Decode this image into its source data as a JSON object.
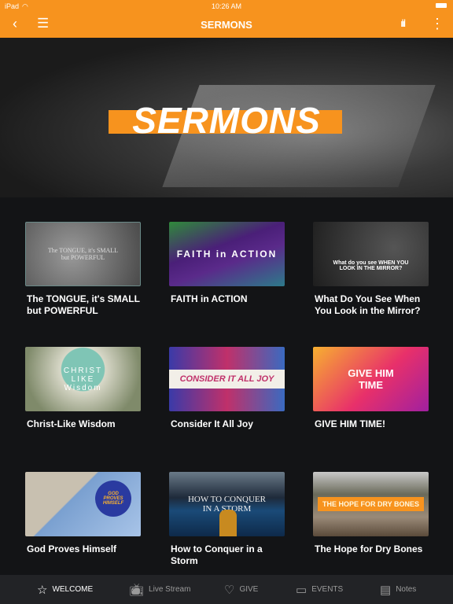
{
  "status": {
    "device": "iPad",
    "time": "10:26 AM"
  },
  "nav": {
    "title": "SERMONS",
    "back_icon": "chevron-left-icon",
    "menu_icon": "hamburger-icon",
    "audio_icon": "equalizer-icon",
    "more_icon": "more-vertical-icon"
  },
  "hero": {
    "title": "SERMONS"
  },
  "accent": "#F7931E",
  "sermons": [
    {
      "title": "The TONGUE, it's SMALL but POWERFUL",
      "art": "The TONGUE, it's SMALL but POWERFUL"
    },
    {
      "title": "FAITH in ACTION",
      "art": "FAITH in ACTION"
    },
    {
      "title": "What Do You See When You Look in the Mirror?",
      "art": "What do you see WHEN YOU LOOK IN THE MIRROR?"
    },
    {
      "title": "Christ-Like Wisdom",
      "art": "CHRIST LIKE Wisdom"
    },
    {
      "title": "Consider It All Joy",
      "art": "CONSIDER IT ALL JOY"
    },
    {
      "title": "GIVE HIM TIME!",
      "art": "GIVE HIM TIME"
    },
    {
      "title": "God Proves Himself",
      "art": "GOD PROVES HIMSELF"
    },
    {
      "title": "How to Conquer in a Storm",
      "art": "HOW TO CONQUER IN A STORM"
    },
    {
      "title": "The Hope for Dry Bones",
      "art": "THE HOPE FOR DRY BONES"
    }
  ],
  "tabs": [
    {
      "label": "WELCOME",
      "icon": "star-icon",
      "active": true
    },
    {
      "label": "Live Stream",
      "icon": "tv-icon"
    },
    {
      "label": "GIVE",
      "icon": "heart-icon"
    },
    {
      "label": "EVENTS",
      "icon": "calendar-icon"
    },
    {
      "label": "Notes",
      "icon": "notebook-icon"
    }
  ]
}
